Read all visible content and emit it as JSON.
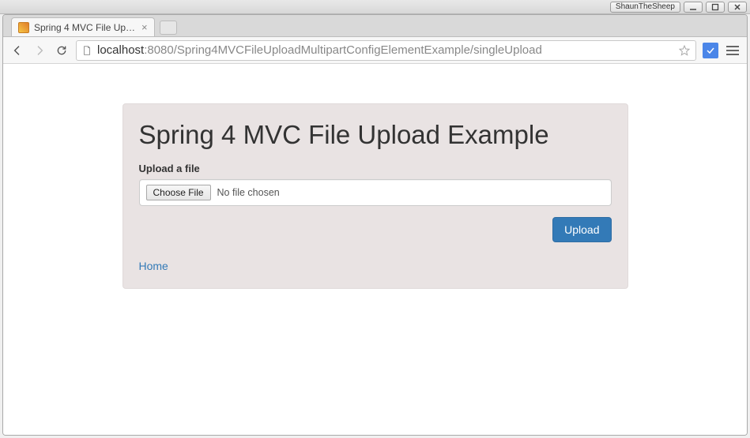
{
  "os": {
    "username": "ShaunTheSheep"
  },
  "browser": {
    "tab_title": "Spring 4 MVC File Upload",
    "url_host": "localhost",
    "url_port": ":8080",
    "url_path": "/Spring4MVCFileUploadMultipartConfigElementExample/singleUpload"
  },
  "page": {
    "heading": "Spring 4 MVC File Upload Example",
    "upload_label": "Upload a file",
    "choose_file_label": "Choose File",
    "file_status": "No file chosen",
    "upload_button": "Upload",
    "home_link": "Home"
  }
}
